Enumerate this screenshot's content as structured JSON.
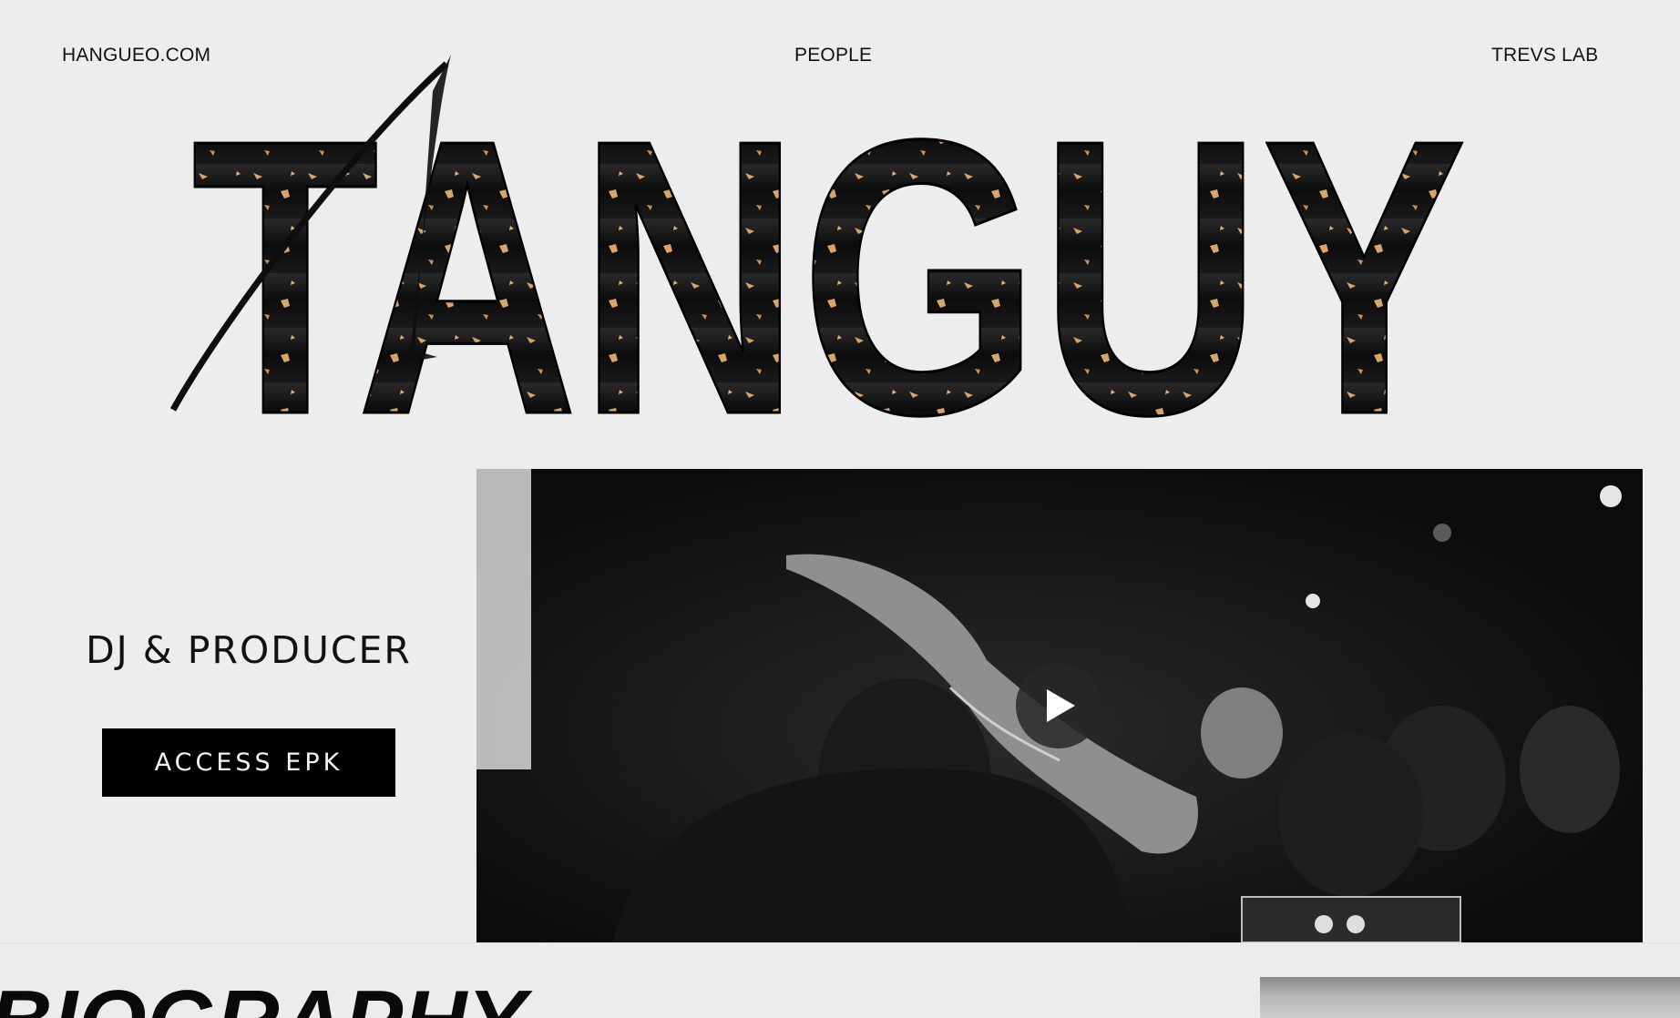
{
  "nav": {
    "left_label": "HANGUEO.COM",
    "center_label": "PEOPLE",
    "right_label": "TREVS LAB"
  },
  "hero": {
    "logo_text": "TANGUY",
    "role": "DJ & PRODUCER",
    "cta_label": "ACCESS EPK"
  },
  "video": {
    "play_icon": "play-icon"
  },
  "biography": {
    "heading": "BIOGRAPHY"
  },
  "colors": {
    "background": "#ededed",
    "text": "#111111",
    "button_bg": "#000000",
    "logo_fill": "#121212",
    "logo_accent": "#d9a46a"
  }
}
